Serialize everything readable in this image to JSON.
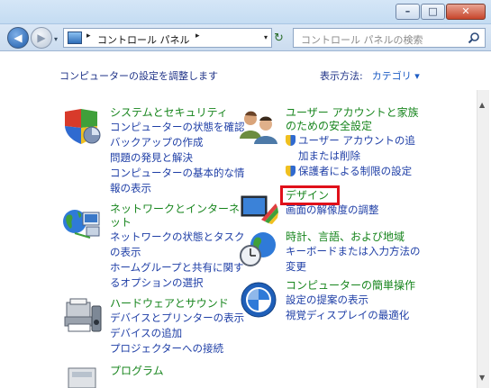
{
  "window": {
    "min_glyph": "–",
    "max_glyph": "□",
    "close_glyph": "✕"
  },
  "nav": {
    "back_glyph": "◀",
    "fwd_glyph": "▶",
    "recent_glyph": "▾"
  },
  "address": {
    "separator": "▸",
    "path": "コントロール パネル",
    "trail_separator": "▸",
    "dropdown_glyph": "▾",
    "refresh_glyph": "↻"
  },
  "search": {
    "placeholder": "コントロール パネルの検索"
  },
  "main": {
    "heading": "コンピューターの設定を調整します",
    "view_by_label": "表示方法:",
    "view_by_value": "カテゴリ ▾"
  },
  "categories": {
    "system": {
      "title": "システムとセキュリティ",
      "links": [
        "コンピューターの状態を確認",
        "バックアップの作成",
        "問題の発見と解決",
        "コンピューターの基本的な情",
        "報の表示"
      ]
    },
    "network": {
      "title": "ネットワークとインターネ",
      "title2": "ット",
      "links": [
        "ネットワークの状態とタスク",
        "の表示",
        "ホームグループと共有に関す",
        "るオプションの選択"
      ]
    },
    "hardware": {
      "title": "ハードウェアとサウンド",
      "links": [
        "デバイスとプリンターの表示",
        "デバイスの追加",
        "プロジェクターへの接続"
      ]
    },
    "programs": {
      "title": "プログラム"
    },
    "accounts": {
      "title": "ユーザー アカウントと家族",
      "title2": "のための安全設定",
      "links": [
        "ユーザー アカウントの追",
        "加または削除",
        "保護者による制限の設定"
      ]
    },
    "appearance": {
      "title": "デザイン",
      "links": [
        "画面の解像度の調整"
      ]
    },
    "clock": {
      "title": "時計、言語、および地域",
      "links": [
        "キーボードまたは入力方法の",
        "変更"
      ]
    },
    "ease": {
      "title": "コンピューターの簡単操作",
      "links": [
        "設定の提案の表示",
        "視覚ディスプレイの最適化"
      ]
    }
  }
}
